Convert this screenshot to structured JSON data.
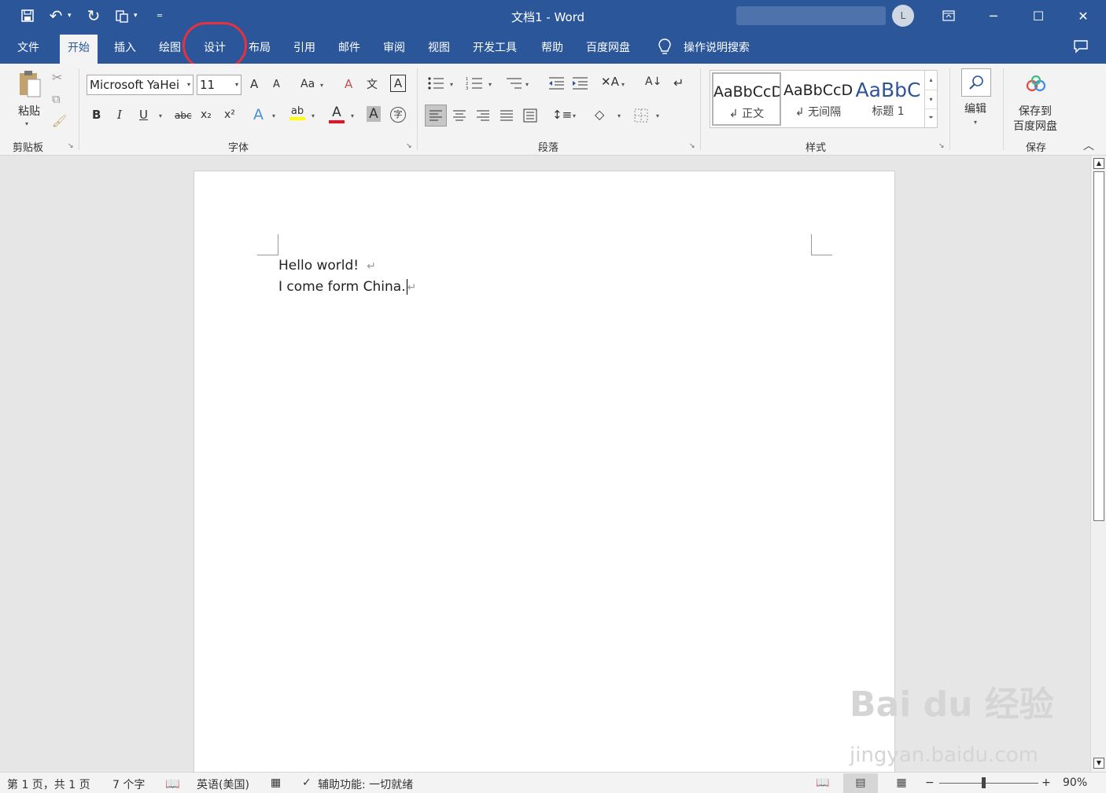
{
  "titlebar": {
    "doc_title": "文档1  -  Word",
    "avatar_initial": "L",
    "qat": {
      "save_icon": "💾",
      "undo_icon": "↶",
      "redo_icon": "↻",
      "format_icon": "📋",
      "customize_icon": "▾"
    },
    "controls": {
      "restore_icon": "⧉",
      "minimize_icon": "─",
      "maximize_icon": "☐",
      "close_icon": "✕"
    }
  },
  "tabs": {
    "items": [
      "文件",
      "开始",
      "插入",
      "绘图",
      "设计",
      "布局",
      "引用",
      "邮件",
      "审阅",
      "视图",
      "开发工具",
      "帮助",
      "百度网盘"
    ],
    "active": "开始",
    "highlighted": "设计",
    "search_label": "操作说明搜索"
  },
  "ribbon": {
    "clipboard": {
      "paste_label": "粘贴",
      "group_label": "剪贴板"
    },
    "font": {
      "font_name": "Microsoft YaHei",
      "font_size": "11",
      "group_label": "字体",
      "grow": "A",
      "shrink": "A",
      "case": "Aa",
      "bold": "B",
      "italic": "I",
      "underline": "U",
      "strike": "abc",
      "sub": "x₂",
      "sup": "x²",
      "text_effect": "A",
      "highlight": "ab",
      "font_color": "A",
      "char_shade": "A",
      "enclose": "字",
      "clear_format": "A",
      "phonetic": "文",
      "font_color_hex": "#e81123",
      "highlight_hex": "#ffff00"
    },
    "paragraph": {
      "group_label": "段落"
    },
    "styles": {
      "group_label": "样式",
      "items": [
        {
          "sample": "AaBbCcDd",
          "name": "↲ 正文"
        },
        {
          "sample": "AaBbCcDd",
          "name": "↲ 无间隔"
        },
        {
          "sample": "AaBbC",
          "name": "标题 1"
        }
      ]
    },
    "editing": {
      "label": "编辑"
    },
    "save": {
      "label_line1": "保存到",
      "label_line2": "百度网盘",
      "group_label": "保存"
    }
  },
  "document": {
    "lines": [
      "Hello world!",
      "I come form China."
    ],
    "para_mark": "↵"
  },
  "watermark": {
    "brand": "Bai du 经验",
    "url": "jingyan.baidu.com"
  },
  "statusbar": {
    "page": "第 1 页，共 1 页",
    "words": "7 个字",
    "language": "英语(美国)",
    "accessibility": "辅助功能: 一切就绪",
    "zoom": "90%",
    "zoom_level_percent": 90
  },
  "colors": {
    "brand_blue": "#2b579a",
    "highlight_ring": "#e8313f"
  }
}
